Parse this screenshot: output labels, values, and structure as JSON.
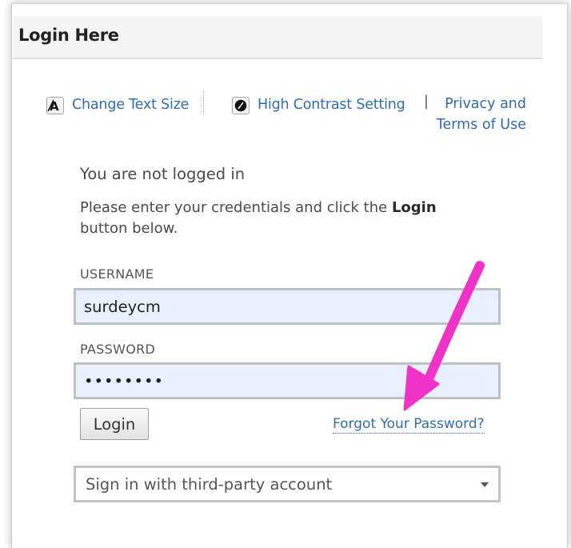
{
  "header": {
    "title": "Login Here"
  },
  "toolbar": {
    "text_size": {
      "label": "Change Text Size",
      "icon": "text-size-icon"
    },
    "contrast": {
      "label": "High Contrast Setting",
      "icon": "contrast-icon"
    },
    "separator": "|",
    "privacy_line1": "Privacy and",
    "privacy_line2": "Terms of Use"
  },
  "status": {
    "message": "You are not logged in"
  },
  "instructions": {
    "before": "Please enter your credentials and click the ",
    "bold": "Login",
    "after": " button below."
  },
  "form": {
    "username_label": "USERNAME",
    "username_value": "surdeycm",
    "password_label": "PASSWORD",
    "password_value": "••••••••",
    "login_label": "Login",
    "forgot_label": "Forgot Your Password?"
  },
  "third_party": {
    "selected": "Sign in with third-party account"
  },
  "colors": {
    "link": "#2f6db0",
    "input_bg": "#e9f0fd",
    "annotation_arrow": "#f032c8"
  }
}
